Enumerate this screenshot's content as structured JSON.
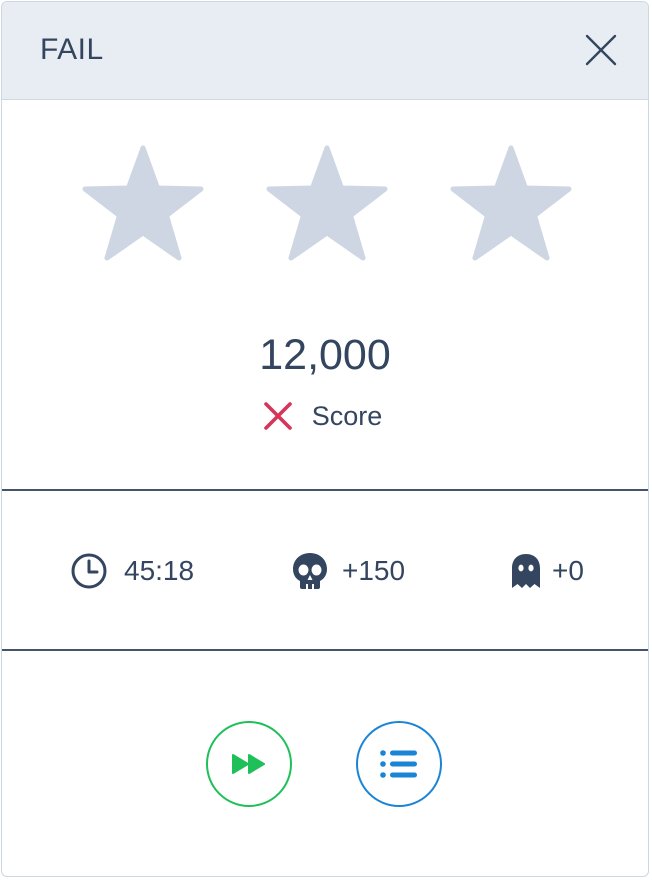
{
  "header": {
    "title": "FAIL",
    "close_icon": "close-icon"
  },
  "rating": {
    "stars_earned": 0,
    "stars_total": 3,
    "star_color": "#cdd6e2"
  },
  "score": {
    "value": "12,000",
    "label": "Score",
    "status_icon": "cross-icon",
    "status_color": "#d6345a"
  },
  "stats": {
    "time": {
      "icon": "clock-icon",
      "value": "45:18"
    },
    "kills": {
      "icon": "skull-icon",
      "value": "+150"
    },
    "ghosts": {
      "icon": "ghost-icon",
      "value": "+0"
    }
  },
  "actions": {
    "continue": {
      "icon": "fast-forward-icon",
      "color": "#1fbf5a"
    },
    "menu": {
      "icon": "list-icon",
      "color": "#1a84d6"
    }
  },
  "colors": {
    "text": "#34465f",
    "header_bg": "#e8edf4",
    "divider": "#45536a"
  }
}
